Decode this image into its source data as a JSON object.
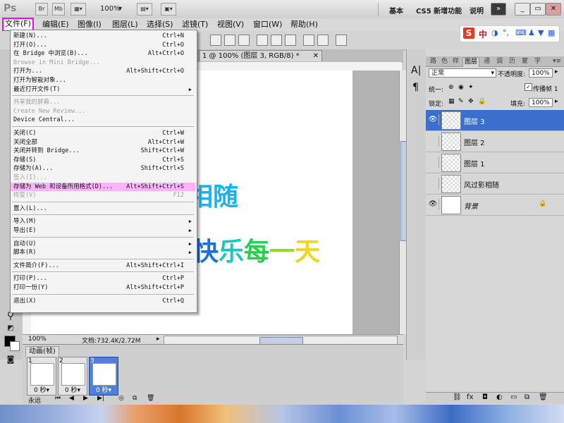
{
  "app": {
    "logo": "Ps",
    "bridge_btn": "Br",
    "mini_bridge_btn": "Mb",
    "zoom": "100%",
    "workspace_basic": "基本",
    "workspace_cs5": "CS5 新增功能",
    "help_label": "说明"
  },
  "menubar": {
    "items": [
      "文件(F)",
      "编辑(E)",
      "图像(I)",
      "图层(L)",
      "选择(S)",
      "滤镜(T)",
      "视图(V)",
      "窗口(W)",
      "帮助(H)"
    ]
  },
  "sogou": {
    "text": "中"
  },
  "document": {
    "tab_title": "1 @ 100% (图层 3, RGB/8) *",
    "zoom": "100%",
    "doc_info": "文档:732.4K/2.72M",
    "canvas_text1": "相随",
    "canvas_text2": "快乐每一天"
  },
  "file_menu": {
    "items": [
      {
        "label": "新建(N)...",
        "shortcut": "Ctrl+N",
        "disabled": false,
        "submenu": false
      },
      {
        "label": "打开(O)...",
        "shortcut": "Ctrl+O",
        "disabled": false,
        "submenu": false
      },
      {
        "label": "在 Bridge 中浏览(B)...",
        "shortcut": "Alt+Ctrl+O",
        "disabled": false,
        "submenu": false
      },
      {
        "label": "Browse in Mini Bridge...",
        "shortcut": "",
        "disabled": true,
        "submenu": false
      },
      {
        "label": "打开为...",
        "shortcut": "Alt+Shift+Ctrl+O",
        "disabled": false,
        "submenu": false
      },
      {
        "label": "打开为智能对象...",
        "shortcut": "",
        "disabled": false,
        "submenu": false
      },
      {
        "label": "最近打开文件(T)",
        "shortcut": "",
        "disabled": false,
        "submenu": true
      },
      {
        "sep": true
      },
      {
        "label": "共享我的屏幕...",
        "shortcut": "",
        "disabled": true,
        "submenu": false
      },
      {
        "label": "Create New Review...",
        "shortcut": "",
        "disabled": true,
        "submenu": false
      },
      {
        "label": "Device Central...",
        "shortcut": "",
        "disabled": false,
        "submenu": false
      },
      {
        "sep": true
      },
      {
        "label": "关闭(C)",
        "shortcut": "Ctrl+W",
        "disabled": false,
        "submenu": false
      },
      {
        "label": "关闭全部",
        "shortcut": "Alt+Ctrl+W",
        "disabled": false,
        "submenu": false
      },
      {
        "label": "关闭并转到 Bridge...",
        "shortcut": "Shift+Ctrl+W",
        "disabled": false,
        "submenu": false
      },
      {
        "label": "存储(S)",
        "shortcut": "Ctrl+S",
        "disabled": false,
        "submenu": false
      },
      {
        "label": "存储为(A)...",
        "shortcut": "Shift+Ctrl+S",
        "disabled": false,
        "submenu": false
      },
      {
        "label": "签入(I)...",
        "shortcut": "",
        "disabled": true,
        "submenu": false
      },
      {
        "label": "存储为 Web 和设备所用格式(D)...",
        "shortcut": "Alt+Shift+Ctrl+S",
        "disabled": false,
        "submenu": false,
        "highlight": true
      },
      {
        "label": "恢复(V)",
        "shortcut": "F12",
        "disabled": true,
        "submenu": false
      },
      {
        "sep": true
      },
      {
        "label": "置入(L)...",
        "shortcut": "",
        "disabled": false,
        "submenu": false
      },
      {
        "sep": true
      },
      {
        "label": "导入(M)",
        "shortcut": "",
        "disabled": false,
        "submenu": true
      },
      {
        "label": "导出(E)",
        "shortcut": "",
        "disabled": false,
        "submenu": true
      },
      {
        "sep": true
      },
      {
        "label": "自动(U)",
        "shortcut": "",
        "disabled": false,
        "submenu": true
      },
      {
        "label": "脚本(R)",
        "shortcut": "",
        "disabled": false,
        "submenu": true
      },
      {
        "sep": true
      },
      {
        "label": "文件简介(F)...",
        "shortcut": "Alt+Shift+Ctrl+I",
        "disabled": false,
        "submenu": false
      },
      {
        "sep": true
      },
      {
        "label": "打印(P)...",
        "shortcut": "Ctrl+P",
        "disabled": false,
        "submenu": false
      },
      {
        "label": "打印一份(Y)",
        "shortcut": "Alt+Shift+Ctrl+P",
        "disabled": false,
        "submenu": false
      },
      {
        "sep": true
      },
      {
        "label": "退出(X)",
        "shortcut": "Ctrl+Q",
        "disabled": false,
        "submenu": false
      }
    ]
  },
  "animation": {
    "tab": "动画(帧)",
    "loop": "永远",
    "frames": [
      {
        "num": "1",
        "delay": "0 秒▾",
        "selected": false
      },
      {
        "num": "2",
        "delay": "0 秒▾",
        "selected": false
      },
      {
        "num": "3",
        "delay": "0 秒▾",
        "selected": true
      }
    ]
  },
  "layers_panel": {
    "tabs": [
      "路",
      "色",
      "样",
      "图层",
      "通",
      "调",
      "历",
      "蒙",
      "字"
    ],
    "active_tab": "图层",
    "blend_mode": "正常",
    "opacity_label": "不透明度:",
    "opacity": "100%",
    "unify_label": "统一:",
    "propagate_label": "传播帧 1",
    "lock_label": "锁定:",
    "fill_label": "填充:",
    "fill": "100%",
    "layers": [
      {
        "name": "图层 3",
        "visible": true,
        "selected": true,
        "locked": false
      },
      {
        "name": "图层 2",
        "visible": false,
        "selected": false,
        "locked": false
      },
      {
        "name": "图层 1",
        "visible": false,
        "selected": false,
        "locked": false
      },
      {
        "name": "风过影相随",
        "visible": false,
        "selected": false,
        "locked": false
      },
      {
        "name": "背景",
        "visible": true,
        "selected": false,
        "locked": true
      }
    ]
  },
  "colors": {
    "file_menu_highlight": "#ff00ff",
    "menu_item_highlight": "#ffb3ff",
    "selected_layer": "#3a6fcd",
    "canvas_text_cyan": "#16b5f0"
  }
}
